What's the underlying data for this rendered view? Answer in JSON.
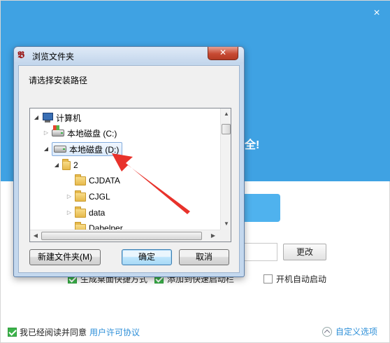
{
  "installer": {
    "close_icon": "×",
    "slogan": "全!",
    "path_value": "",
    "change_button": "更改",
    "options": [
      {
        "label": "生成桌面快捷方式",
        "checked": true
      },
      {
        "label": "添加到快速启动栏",
        "checked": true
      },
      {
        "label": "开机自动启动",
        "checked": false
      }
    ],
    "agree_text": "我已经阅读并同意",
    "license_link": "用户许可协议",
    "agree_checked": true,
    "custom_options": "自定义选项"
  },
  "dialog": {
    "title": "浏览文件夹",
    "close_glyph": "✕",
    "prompt": "请选择安装路径",
    "tree": [
      {
        "label": "计算机",
        "icon": "computer-icon",
        "expanded": true
      },
      {
        "label": "本地磁盘 (C:)",
        "icon": "windows-drive-icon",
        "expanded": false
      },
      {
        "label": "本地磁盘 (D:)",
        "icon": "drive-icon",
        "expanded": true,
        "selected": true
      },
      {
        "label": "2",
        "icon": "folder-icon",
        "expanded": true
      },
      {
        "label": "CJDATA",
        "icon": "folder-icon",
        "expanded": null
      },
      {
        "label": "CJGL",
        "icon": "folder-icon",
        "expanded": false
      },
      {
        "label": "data",
        "icon": "folder-icon",
        "expanded": false
      },
      {
        "label": "Dabelper",
        "icon": "folder-icon",
        "expanded": null
      }
    ],
    "buttons": {
      "new_folder": "新建文件夹(M)",
      "ok": "确定",
      "cancel": "取消"
    }
  },
  "colors": {
    "header_blue": "#3fa2e3",
    "annotation_red": "#e8322b",
    "link_blue": "#2d8fd8",
    "check_green": "#3bb34a"
  }
}
